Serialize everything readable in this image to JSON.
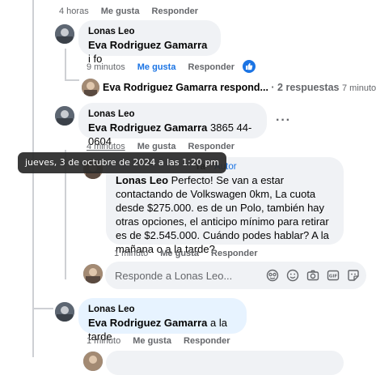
{
  "top_actions": {
    "time": "4 horas",
    "like": "Me gusta",
    "reply": "Responder"
  },
  "comment1": {
    "author": "Lonas Leo",
    "mention": "Eva Rodriguez Gamarra",
    "text": " i fo",
    "time": "9 minutos",
    "like": "Me gusta",
    "reply": "Responder"
  },
  "replies_summary": {
    "author": "Eva Rodriguez Gamarra",
    "label": "respond...",
    "count": "· 2 respuestas",
    "time": "7 minutos"
  },
  "comment2": {
    "author": "Lonas Leo",
    "mention": "Eva Rodriguez Gamarra",
    "text": " 3865 44-0604",
    "time": "4 minutos",
    "like": "Me gusta",
    "reply": "Responder",
    "more": "···"
  },
  "tooltip": {
    "text": "jueves, 3 de octubre de 2024 a las 1:20 pm"
  },
  "reply_eva": {
    "author_fragment": "ra",
    "badge": "Autor",
    "mention": "Lonas Leo",
    "text": " Perfecto! Se van a estar contactando de Volkswagen 0km, La cuota desde $275.000. es de un Polo, también hay otras opciones, el anticipo mínimo para retirar es de $2.545.000. Cuándo podes hablar? A la mañana o a la tarde?",
    "time": "1 minuto",
    "like": "Me gusta",
    "reply": "Responder"
  },
  "reply_box": {
    "placeholder": "Responde a Lonas Leo..."
  },
  "comment3": {
    "author": "Lonas Leo",
    "mention": "Eva Rodriguez Gamarra",
    "text": " a la tarde",
    "time": "1 minuto",
    "like": "Me gusta",
    "reply": "Responder"
  },
  "colors": {
    "accent": "#1b74e4",
    "bubble": "#f0f2f5",
    "bubble_highlight": "#e7f3ff",
    "meta": "#65676b"
  },
  "icons": [
    "like-icon",
    "sticker-icon",
    "emoji-icon",
    "camera-icon",
    "gif-icon",
    "avatar-sticker-icon",
    "more-icon"
  ]
}
